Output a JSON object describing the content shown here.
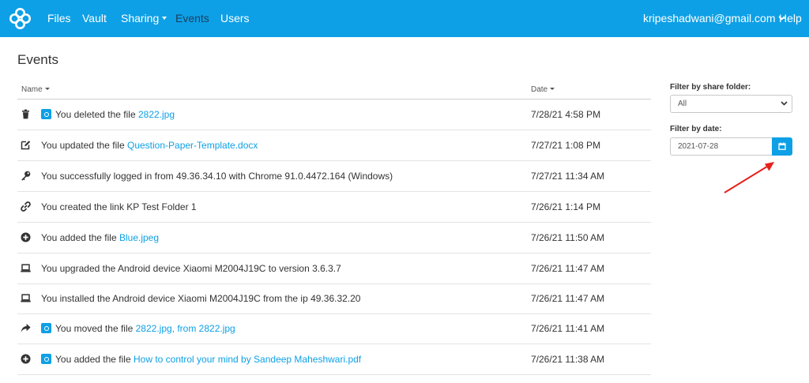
{
  "navbar": {
    "items": {
      "files": "Files",
      "vault": "Vault",
      "sharing": "Sharing",
      "events": "Events",
      "users": "Users"
    },
    "account": "kripeshadwani@gmail.com",
    "help": "Help"
  },
  "page": {
    "title": "Events"
  },
  "table": {
    "col_name": "Name",
    "col_date": "Date",
    "rows": [
      {
        "icon": "trash-icon",
        "has_badge": true,
        "text": "You deleted the file ",
        "link": "2822.jpg",
        "date": "7/28/21 4:58 PM"
      },
      {
        "icon": "edit-icon",
        "has_badge": false,
        "text": "You updated the file ",
        "link": "Question-Paper-Template.docx",
        "date": "7/27/21 1:08 PM"
      },
      {
        "icon": "key-icon",
        "has_badge": false,
        "text": "You successfully logged in from 49.36.34.10 with Chrome 91.0.4472.164 (Windows)",
        "link": "",
        "date": "7/27/21 11:34 AM"
      },
      {
        "icon": "link-icon",
        "has_badge": false,
        "text": "You created the link KP Test Folder 1",
        "link": "",
        "date": "7/26/21 1:14 PM"
      },
      {
        "icon": "plus-circle-icon",
        "has_badge": false,
        "text": "You added the file ",
        "link": "Blue.jpeg",
        "date": "7/26/21 11:50 AM"
      },
      {
        "icon": "laptop-icon",
        "has_badge": false,
        "text": "You upgraded the Android device Xiaomi M2004J19C to version 3.6.3.7",
        "link": "",
        "date": "7/26/21 11:47 AM"
      },
      {
        "icon": "laptop-icon",
        "has_badge": false,
        "text": "You installed the Android device Xiaomi M2004J19C from the ip 49.36.32.20",
        "link": "",
        "date": "7/26/21 11:47 AM"
      },
      {
        "icon": "share-arrow-icon",
        "has_badge": true,
        "text": "You moved the file ",
        "link": "2822.jpg, from 2822.jpg",
        "date": "7/26/21 11:41 AM"
      },
      {
        "icon": "plus-circle-icon",
        "has_badge": true,
        "text": "You added the file ",
        "link": "How to control your mind by Sandeep Maheshwari.pdf",
        "date": "7/26/21 11:38 AM"
      }
    ]
  },
  "filters": {
    "share_folder_label": "Filter by share folder:",
    "share_folder_value": "All",
    "date_label": "Filter by date:",
    "date_value": "2021-07-28"
  },
  "colors": {
    "brand": "#0ea0e6",
    "active_nav": "#1a3e5c",
    "annotation_arrow": "#e8201b"
  }
}
